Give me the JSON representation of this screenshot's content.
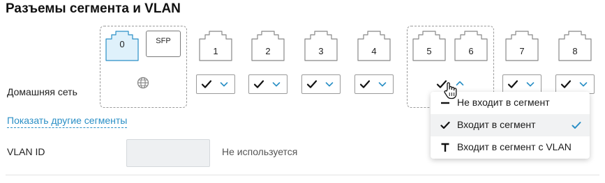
{
  "title": "Разъемы сегмента и VLAN",
  "ports": [
    {
      "label": "0",
      "selected": true
    },
    {
      "label": "SFP"
    },
    {
      "label": "1"
    },
    {
      "label": "2"
    },
    {
      "label": "3"
    },
    {
      "label": "4"
    },
    {
      "label": "5"
    },
    {
      "label": "6"
    },
    {
      "label": "7"
    },
    {
      "label": "8"
    }
  ],
  "row": {
    "label": "Домашняя сеть"
  },
  "show_other_segments": "Показать другие сегменты",
  "vlan": {
    "label": "VLAN ID",
    "value": "",
    "status": "Не используется"
  },
  "dropdown": {
    "options": [
      {
        "label": "Не входит в сегмент",
        "icon": "minus-icon"
      },
      {
        "label": "Входит в сегмент",
        "icon": "check-icon",
        "selected": true
      },
      {
        "label": "Входит в сегмент с VLAN",
        "icon": "tagged-icon"
      }
    ]
  },
  "colors": {
    "accent": "#2a8fc6",
    "selected_port_fill": "#dff1fb",
    "border": "#9a9a9a"
  }
}
